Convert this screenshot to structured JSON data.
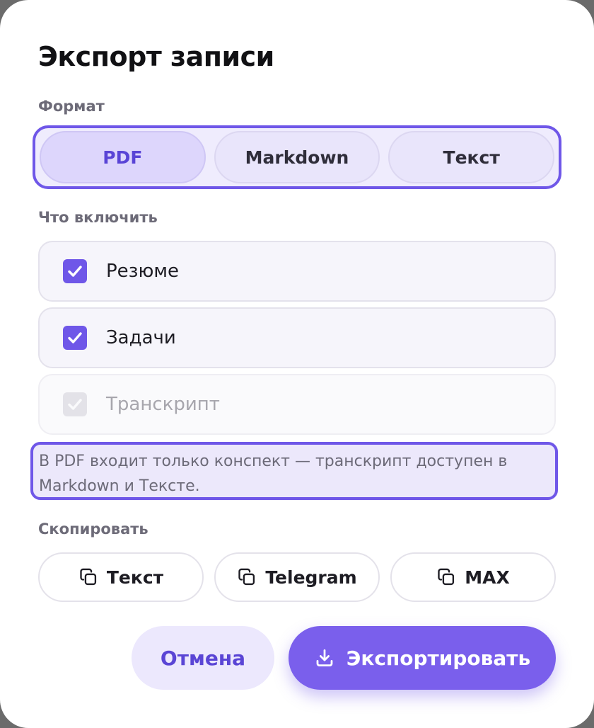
{
  "dialog": {
    "title": "Экспорт записи"
  },
  "format": {
    "label": "Формат",
    "options": [
      "PDF",
      "Markdown",
      "Текст"
    ],
    "selected": "PDF"
  },
  "include": {
    "label": "Что включить",
    "items": [
      {
        "label": "Резюме",
        "checked": true,
        "disabled": false
      },
      {
        "label": "Задачи",
        "checked": true,
        "disabled": false
      },
      {
        "label": "Транскрипт",
        "checked": true,
        "disabled": true
      }
    ]
  },
  "note": "В PDF входит только конспект — транскрипт доступен в Markdown и Тексте.",
  "copy": {
    "label": "Скопировать",
    "buttons": [
      "Текст",
      "Telegram",
      "MAX"
    ]
  },
  "actions": {
    "cancel_label": "Отмена",
    "export_label": "Экспортировать"
  },
  "colors": {
    "accent": "#6f57e8",
    "accent_light": "#ece8fd"
  },
  "icons": {
    "check": "checkmark-icon",
    "copy": "copy-icon",
    "export": "download-icon"
  }
}
